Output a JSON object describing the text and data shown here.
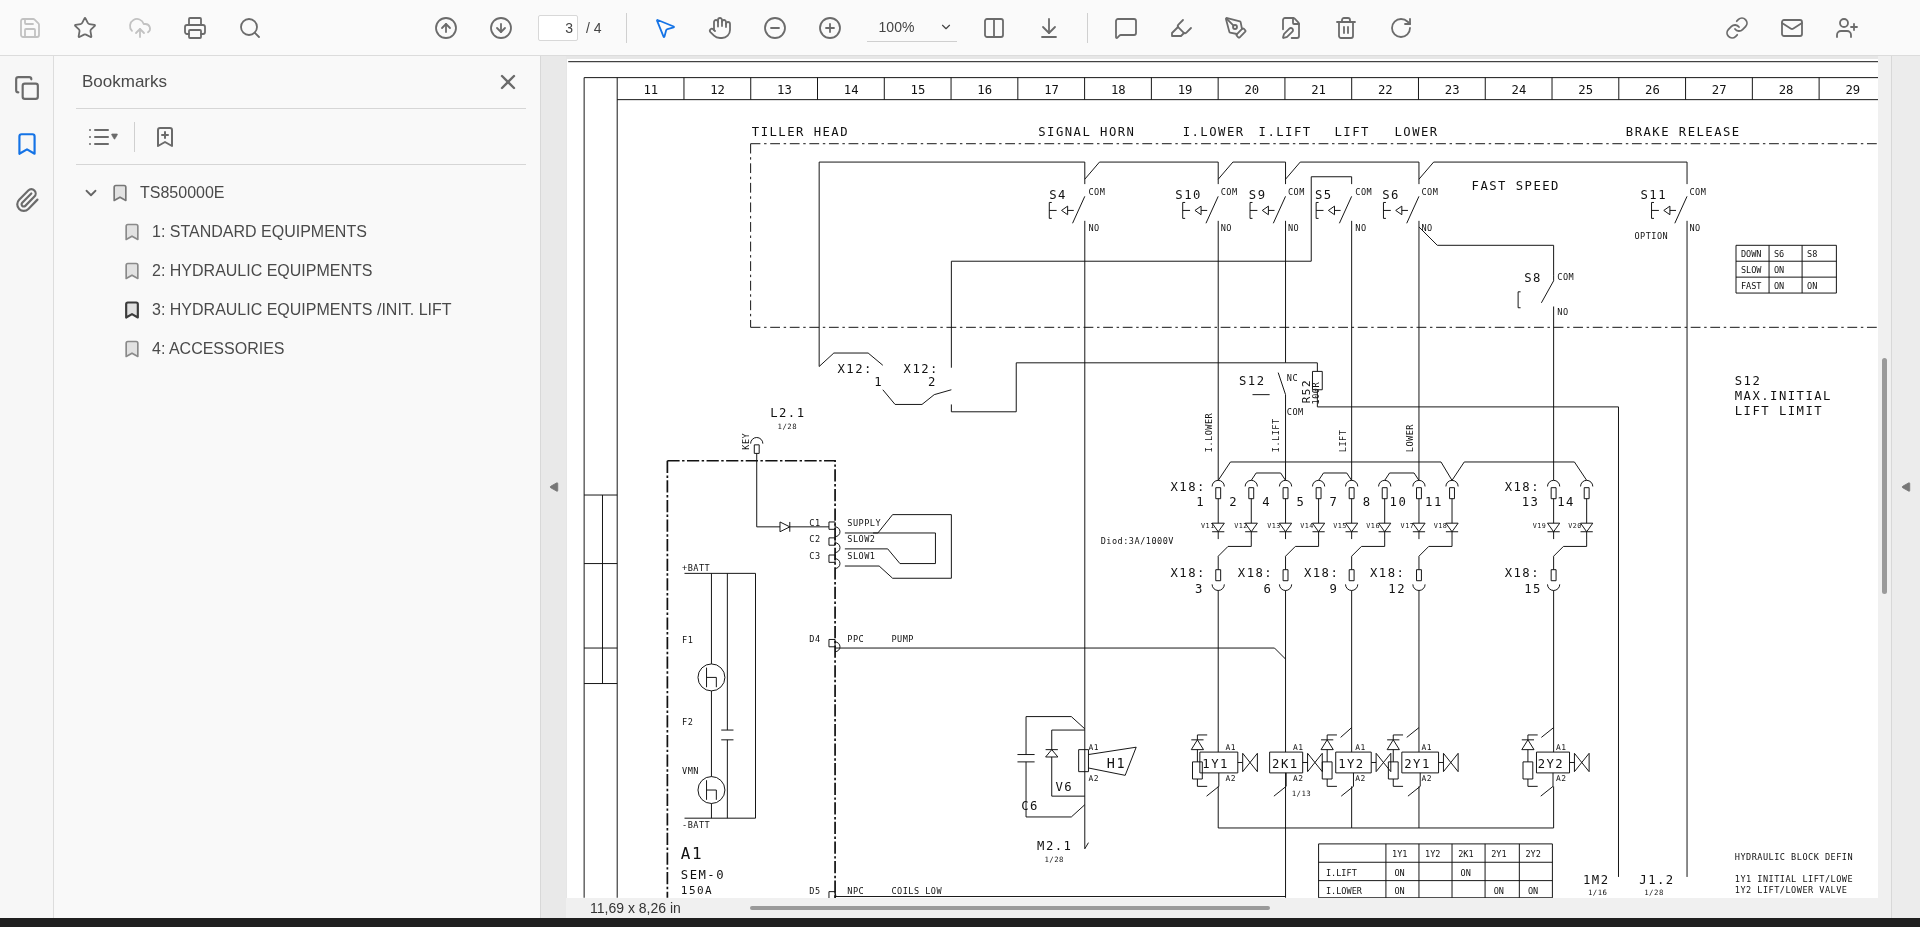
{
  "toolbar": {
    "file_actions": [
      {
        "kind": "save",
        "disabled": true
      },
      {
        "kind": "star",
        "disabled": false
      },
      {
        "kind": "upload",
        "disabled": true
      },
      {
        "kind": "print",
        "disabled": false
      },
      {
        "kind": "find",
        "disabled": false
      }
    ],
    "nav": [
      {
        "kind": "up"
      },
      {
        "kind": "down"
      }
    ],
    "page": {
      "current": "3",
      "total": "/ 4"
    },
    "pointer_tools": [
      {
        "kind": "select",
        "selected": true
      },
      {
        "kind": "hand",
        "selected": false
      }
    ],
    "zoom_buttons": [
      {
        "kind": "out"
      },
      {
        "kind": "in"
      }
    ],
    "zoom": {
      "value": "100%"
    },
    "view_tools": [
      {
        "kind": "fit"
      },
      {
        "kind": "scroll"
      }
    ],
    "edit_tools": [
      {
        "kind": "comment"
      },
      {
        "kind": "highlight"
      },
      {
        "kind": "sign"
      },
      {
        "kind": "edit"
      },
      {
        "kind": "delete"
      },
      {
        "kind": "rotate"
      }
    ],
    "share_tools": [
      {
        "kind": "link"
      },
      {
        "kind": "mail"
      },
      {
        "kind": "user"
      }
    ]
  },
  "rail": [
    {
      "kind": "pages",
      "selected": false
    },
    {
      "kind": "bookmarks",
      "selected": true
    },
    {
      "kind": "attachments",
      "selected": false
    }
  ],
  "bookmarks": {
    "title": "Bookmarks",
    "tree": [
      {
        "label": "TS850000E",
        "expanded": true,
        "children": [
          {
            "label": "1: STANDARD EQUIPMENTS",
            "selected": false
          },
          {
            "label": "2: HYDRAULIC EQUIPMENTS",
            "selected": false
          },
          {
            "label": "3: HYDRAULIC EQUIPMENTS /INIT. LIFT",
            "selected": true
          },
          {
            "label": "4: ACCESSORIES",
            "selected": false
          }
        ]
      }
    ]
  },
  "schematic": {
    "column_numbers": [
      "11",
      "12",
      "13",
      "14",
      "15",
      "16",
      "17",
      "18",
      "19",
      "20",
      "21",
      "22",
      "23",
      "24",
      "25",
      "26",
      "27",
      "28",
      "29"
    ],
    "labels": [
      "TILLER HEAD",
      "SIGNAL HORN",
      "I.LOWER",
      "I.LIFT",
      "LIFT",
      "LOWER",
      "BRAKE RELEASE",
      "S4",
      "COM",
      "NO",
      "S10",
      "COM",
      "NO",
      "S9",
      "COM",
      "NO",
      "S5",
      "COM",
      "NO",
      "S6",
      "COM",
      "NO",
      "FAST SPEED",
      "S11",
      "COM",
      "NO",
      "OPTION",
      "S8",
      "COM",
      "NO",
      "X12:",
      "1",
      "X12:",
      "2",
      "L2.1",
      "1/28",
      "KEY",
      "S12",
      "NC",
      "COM",
      "R52",
      "100R",
      "S12",
      "MAX.INITIAL",
      "LIFT LIMIT",
      "I.LOWER",
      "I.LIFT",
      "LIFT",
      "LOWER",
      "X18:",
      "1",
      "2",
      "4",
      "5",
      "7",
      "8",
      "10",
      "11",
      "X18:",
      "13",
      "14",
      "V11",
      "V12",
      "V13",
      "V14",
      "V15",
      "V16",
      "V17",
      "V18",
      "V19",
      "V20",
      "Diod:3A/1000V",
      "X18:",
      "3",
      "X18:",
      "6",
      "X18:",
      "9",
      "X18:",
      "12",
      "X18:",
      "15",
      "+BATT",
      "F1",
      "F2",
      "VMN",
      "-BATT",
      "A1",
      "SEM-0",
      "150A",
      "C1",
      "SUPPLY",
      "C2",
      "SLOW2",
      "C3",
      "SLOW1",
      "D4",
      "PPC",
      "PUMP",
      "D5",
      "NPC",
      "COILS LOW",
      "A1",
      "H1",
      "A2",
      "V6",
      "C6",
      "A1",
      "1Y1",
      "A2",
      "A1",
      "2K1",
      "A2",
      "1/13",
      "A1",
      "1Y2",
      "A2",
      "A1",
      "2Y1",
      "A2",
      "A1",
      "2Y2",
      "A2",
      "M2.1",
      "1/28",
      "1M2",
      "1/16",
      "J1.2",
      "1/28",
      "HYDRAULIC BLOCK DEFIN",
      "1Y1 INITIAL LIFT/LOWE",
      "1Y2 LIFT/LOWER VALVE"
    ],
    "speed_table": {
      "rows": [
        [
          "DOWN",
          "S6",
          "S8"
        ],
        [
          "SLOW",
          "ON",
          null
        ],
        [
          "FAST",
          "ON",
          "ON"
        ]
      ]
    },
    "coil_table": {
      "columns": [
        "1Y1",
        "1Y2",
        "2K1",
        "2Y1",
        "2Y2"
      ],
      "rows": [
        {
          "label": "I.LIFT",
          "cells": [
            "ON",
            null,
            "ON",
            null,
            null
          ]
        },
        {
          "label": "I.LOWER",
          "cells": [
            "ON",
            null,
            null,
            "ON",
            "ON"
          ]
        }
      ]
    }
  },
  "status_bar": {
    "page_size": "11,69 x 8,26 in"
  }
}
